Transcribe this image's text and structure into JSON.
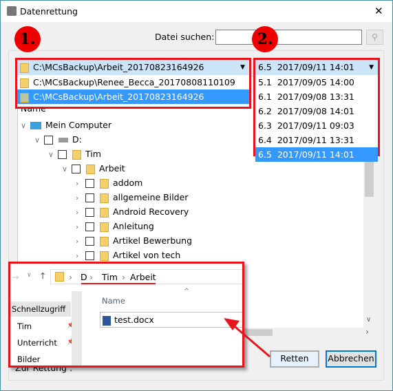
{
  "window": {
    "title": "Datenrettung",
    "close": "✕"
  },
  "search": {
    "label": "Datei suchen:",
    "value": "",
    "placeholder": ""
  },
  "annotations": {
    "step1": "1.",
    "step2": "2."
  },
  "backup_combo": {
    "selected": "C:\\MCsBackup\\Arbeit_20170823164926",
    "options": [
      "C:\\MCsBackup\\Renee_Becca_20170808110109",
      "C:\\MCsBackup\\Arbeit_20170823164926"
    ]
  },
  "version_combo": {
    "selected": "6.5  2017/09/11 14:01",
    "options": [
      "5.1  2017/09/05 14:00",
      "6.1  2017/09/08 13:31",
      "6.2  2017/09/08 14:01",
      "6.3  2017/09/11 09:03",
      "6.4  2017/09/11 13:31",
      "6.5  2017/09/11 14:01"
    ]
  },
  "tree": {
    "header": "Name",
    "rows": [
      {
        "label": "Mein Computer",
        "level": 0
      },
      {
        "label": "D:",
        "level": 1
      },
      {
        "label": "Tim",
        "level": 2
      },
      {
        "label": "Arbeit",
        "level": 3
      },
      {
        "label": "addom",
        "level": 4
      },
      {
        "label": "allgemeine Bilder",
        "level": 4
      },
      {
        "label": "Android Recovery",
        "level": 4
      },
      {
        "label": "Anleitung",
        "level": 4
      },
      {
        "label": "Artikel Bewerbung",
        "level": 4
      },
      {
        "label": "Artikel von tech",
        "level": 4
      }
    ]
  },
  "explorer": {
    "breadcrumb": [
      "D",
      "Tim",
      "Arbeit"
    ],
    "quick_access": "Schnellzugriff",
    "sidebar": [
      "Tim",
      "Unterricht",
      "Bilder"
    ],
    "column": "Name",
    "file": "test.docx"
  },
  "footer": {
    "label": "Zur Rettung :",
    "retten": "Retten",
    "abbrechen": "Abbrechen"
  },
  "colors": {
    "highlight": "#3399ff",
    "annotation": "#e8141c",
    "combo": "#cce4f7"
  }
}
